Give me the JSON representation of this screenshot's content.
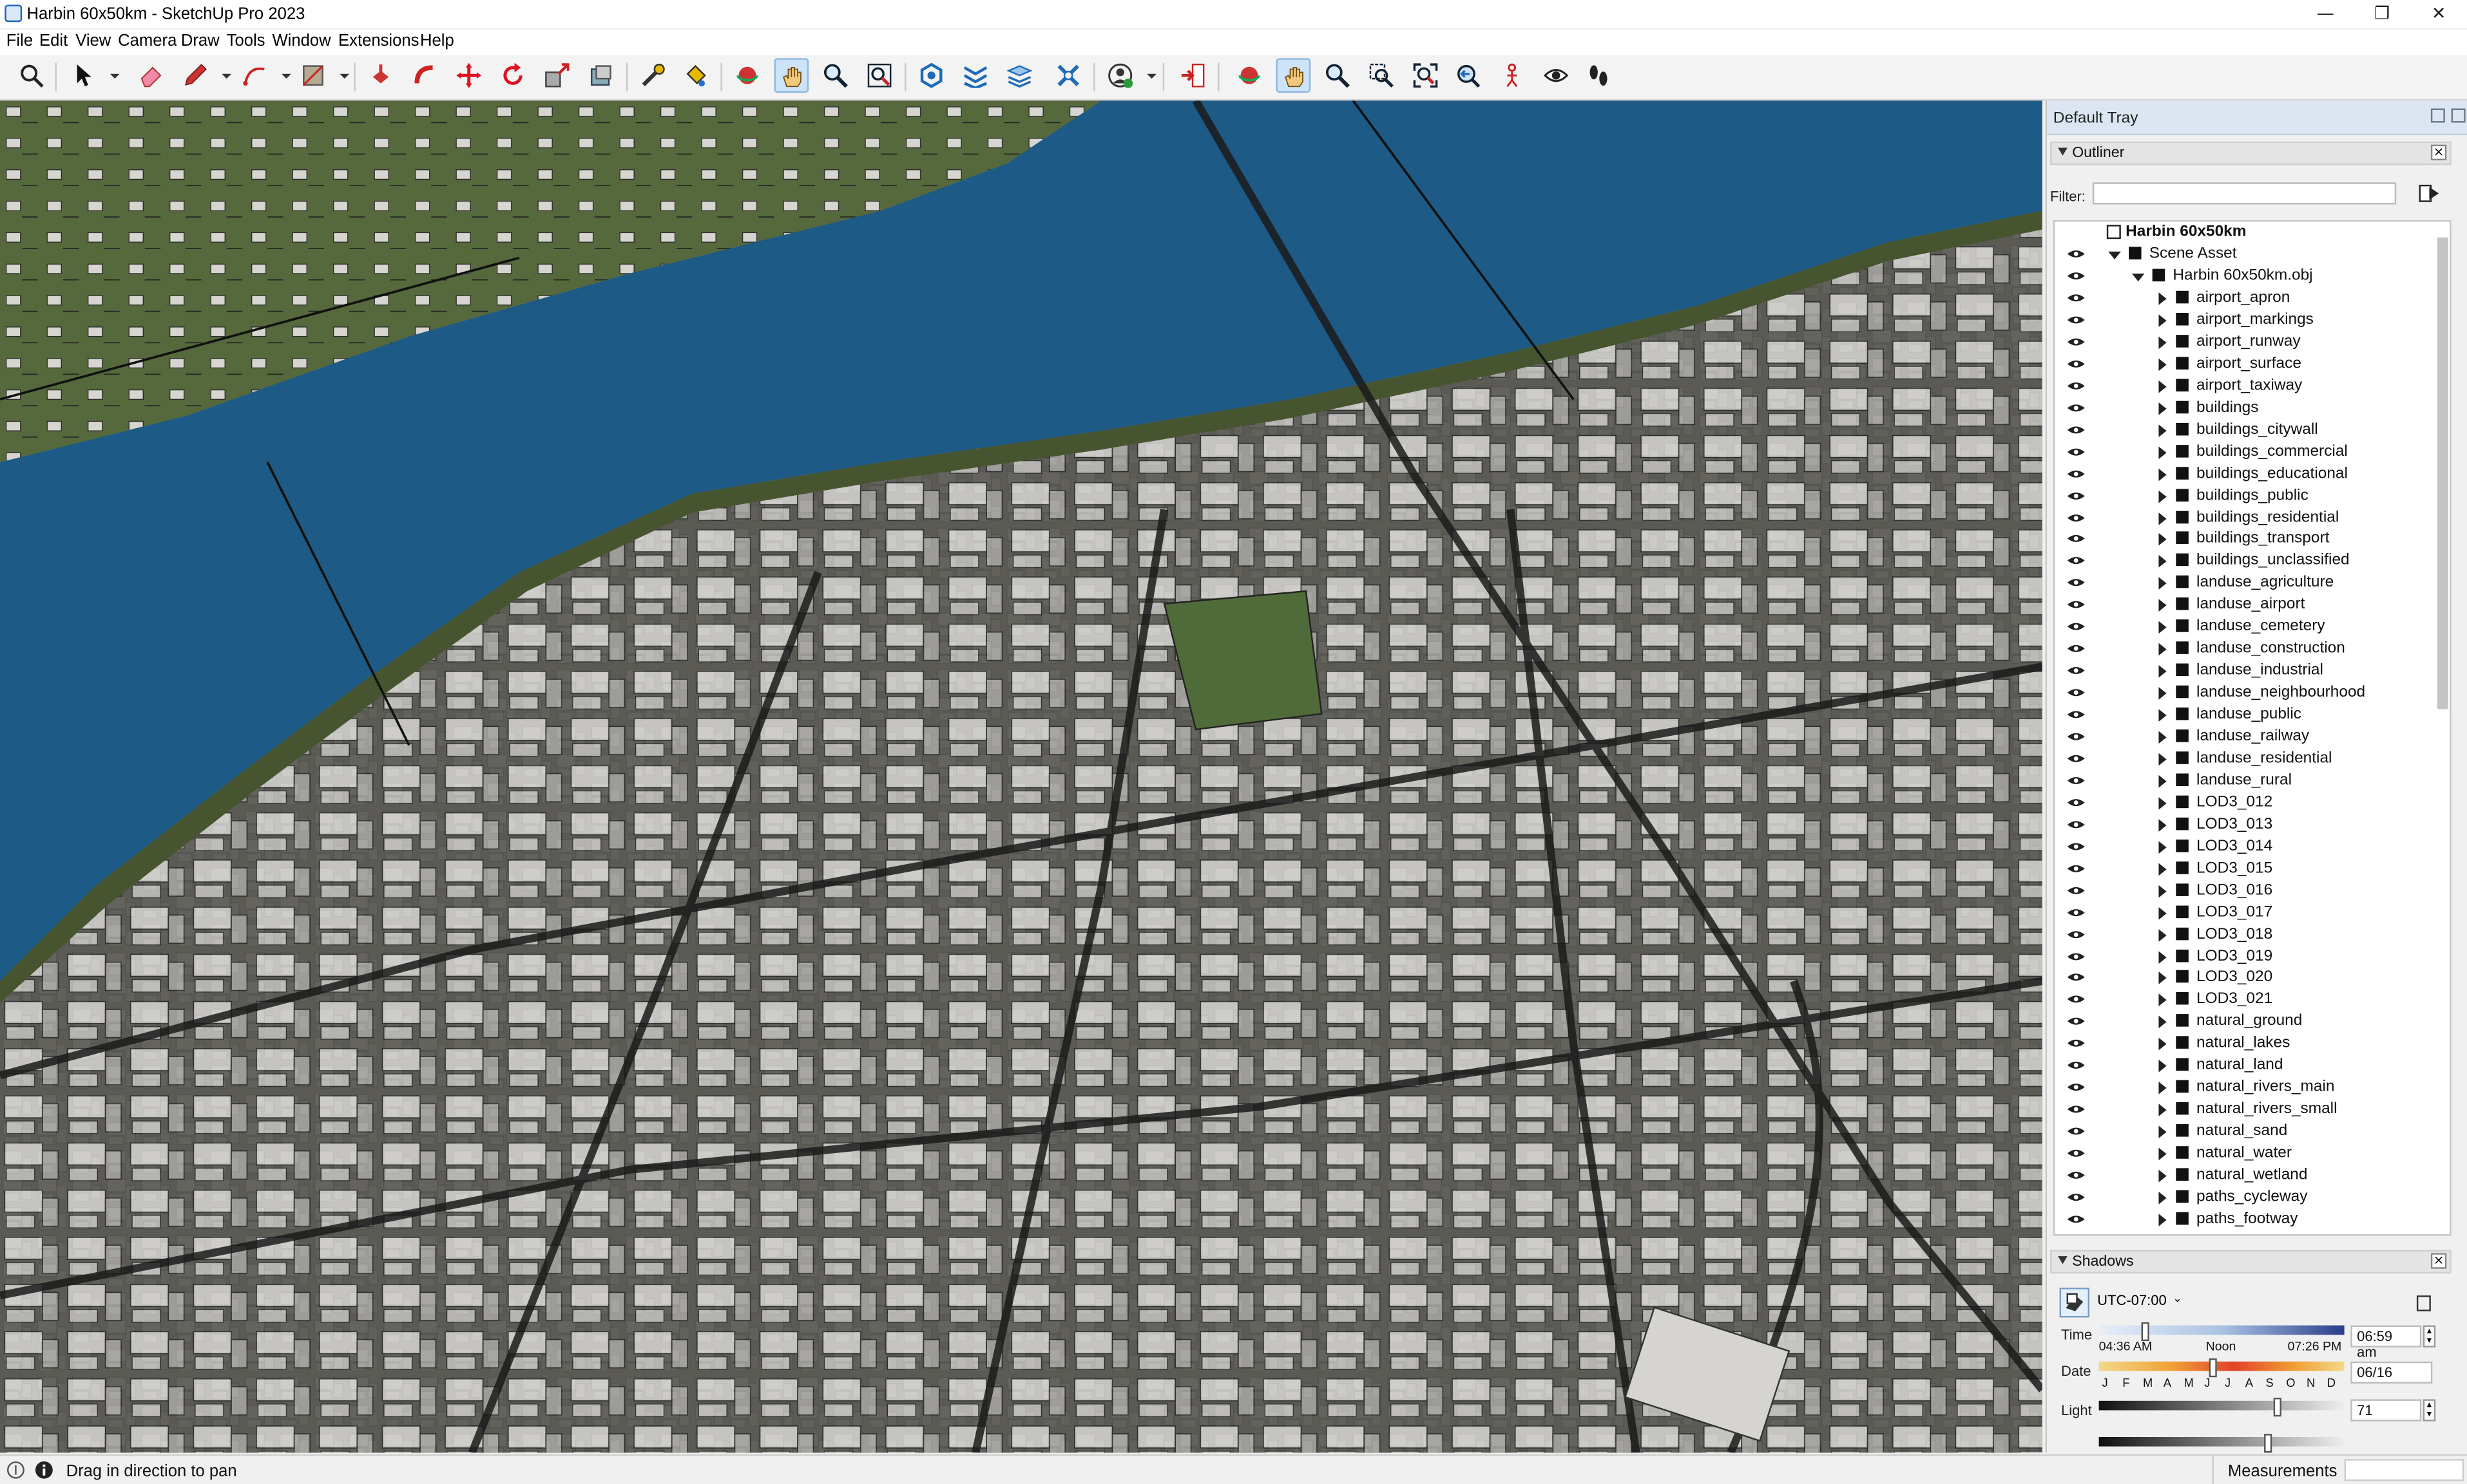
{
  "window": {
    "title": "Harbin 60x50km - SketchUp Pro 2023",
    "controls": {
      "minimize": "—",
      "maximize": "❐",
      "close": "✕"
    }
  },
  "menu": [
    "File",
    "Edit",
    "View",
    "Camera",
    "Draw",
    "Tools",
    "Window",
    "Extensions",
    "Help"
  ],
  "toolbar": {
    "tools": [
      "search-icon",
      "select-icon",
      "eraser-icon",
      "pencil-line-icon",
      "arc-icon",
      "rectangle-icon",
      "push-pull-icon",
      "follow-me-icon",
      "move-icon",
      "rotate-icon",
      "scale-icon",
      "offset-icon",
      "tape-measure-icon",
      "paint-bucket-icon",
      "orbit-icon",
      "pan-icon",
      "zoom-icon",
      "zoom-extents-icon",
      "warehouse-icon",
      "extension-warehouse-icon",
      "layout-icon",
      "style-builder-icon",
      "account-icon",
      "send-to-layout-icon",
      "orbit-icon-2",
      "pan-icon-2",
      "zoom-icon-2",
      "zoom-window-icon",
      "zoom-extents-icon-2",
      "previous-view-icon",
      "position-camera-icon",
      "look-around-icon",
      "walk-icon"
    ],
    "active_tool": "pan-icon"
  },
  "tray": {
    "title": "Default Tray",
    "outliner": {
      "title": "Outliner",
      "filter_label": "Filter:",
      "filter_value": "",
      "root": "Harbin 60x50km",
      "scene": "Scene Asset",
      "obj": "Harbin 60x50km.obj",
      "layers": [
        "airport_apron",
        "airport_markings",
        "airport_runway",
        "airport_surface",
        "airport_taxiway",
        "buildings",
        "buildings_citywall",
        "buildings_commercial",
        "buildings_educational",
        "buildings_public",
        "buildings_residential",
        "buildings_transport",
        "buildings_unclassified",
        "landuse_agriculture",
        "landuse_airport",
        "landuse_cemetery",
        "landuse_construction",
        "landuse_industrial",
        "landuse_neighbourhood",
        "landuse_public",
        "landuse_railway",
        "landuse_residential",
        "landuse_rural",
        "LOD3_012",
        "LOD3_013",
        "LOD3_014",
        "LOD3_015",
        "LOD3_016",
        "LOD3_017",
        "LOD3_018",
        "LOD3_019",
        "LOD3_020",
        "LOD3_021",
        "natural_ground",
        "natural_lakes",
        "natural_land",
        "natural_rivers_main",
        "natural_rivers_small",
        "natural_sand",
        "natural_water",
        "natural_wetland",
        "paths_cycleway",
        "paths_footway"
      ]
    },
    "shadows": {
      "title": "Shadows",
      "timezone": "UTC-07:00",
      "time_label": "Time",
      "time_start": "04:36 AM",
      "time_noon": "Noon",
      "time_end": "07:26 PM",
      "time_value": "06:59 am",
      "time_slider_fraction": 0.17,
      "date_label": "Date",
      "months": [
        "J",
        "F",
        "M",
        "A",
        "M",
        "J",
        "J",
        "A",
        "S",
        "O",
        "N",
        "D"
      ],
      "date_value": "06/16",
      "date_slider_fraction": 0.45,
      "light_label": "Light",
      "light_value": "71",
      "light_slider_fraction": 0.71,
      "dark_slider_fraction": 0.67
    }
  },
  "status": {
    "text": "Drag in direction to pan",
    "measurements_label": "Measurements"
  }
}
